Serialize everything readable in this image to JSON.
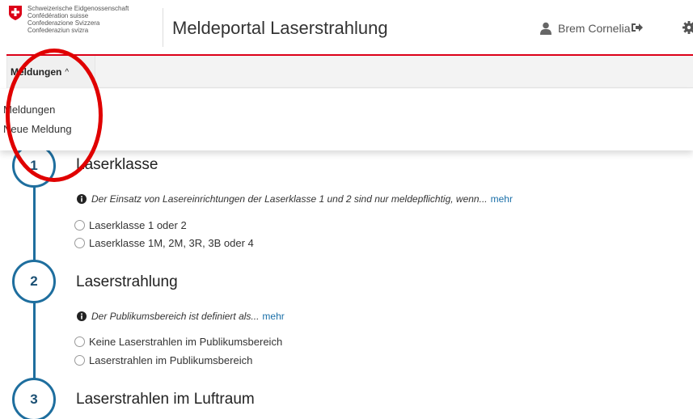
{
  "header": {
    "confederation_lines": [
      "Schweizerische Eidgenossenschaft",
      "Confédération suisse",
      "Confederazione Svizzera",
      "Confederaziun svizra"
    ],
    "app_title": "Meldeportal Laserstrahlung",
    "user_name": "Brem Cornelia"
  },
  "navbar": {
    "tab_label": "Meldungen",
    "tab_chevron": "^"
  },
  "dropdown": {
    "items": [
      "Meldungen",
      "Neue Meldung"
    ]
  },
  "steps": [
    {
      "number": "1",
      "title": "Laserklasse",
      "info": "Der Einsatz von Lasereinrichtungen der Laserklasse 1 und 2 sind nur meldepflichtig, wenn...",
      "more": "mehr",
      "options": [
        "Laserklasse 1 oder 2",
        "Laserklasse 1M, 2M, 3R, 3B oder 4"
      ]
    },
    {
      "number": "2",
      "title": "Laserstrahlung",
      "info": "Der Publikumsbereich ist definiert als...",
      "more": "mehr",
      "options": [
        "Keine Laserstrahlen im Publikumsbereich",
        "Laserstrahlen im Publikumsbereich"
      ]
    },
    {
      "number": "3",
      "title": "Laserstrahlen im Luftraum"
    }
  ],
  "colors": {
    "accent_red": "#dc0018",
    "step_blue": "#1e6e9e",
    "link_blue": "#1a6fa8",
    "highlight_red": "#e00000"
  }
}
